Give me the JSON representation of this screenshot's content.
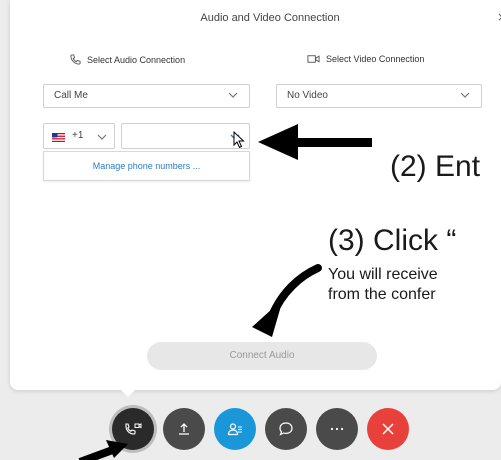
{
  "dialog": {
    "title": "Audio and Video Connection",
    "close_glyph": "×",
    "audio_section_label": "Select Audio Connection",
    "video_section_label": "Select Video Connection",
    "audio_select_value": "Call Me",
    "video_select_value": "No Video",
    "country_code": "+1",
    "phone_number_value": "",
    "manage_link": "Manage phone numbers ...",
    "connect_button": "Connect Audio"
  },
  "icons": {
    "audio": "phone-icon",
    "video": "camera-icon",
    "flag": "us-flag-icon",
    "close": "close-icon"
  },
  "toolbar": {
    "buttons": [
      {
        "name": "audio-connect-button",
        "icon": "phone-video-icon",
        "color": "#2a2a2a"
      },
      {
        "name": "share-button",
        "icon": "upload-icon",
        "color": "#4a4a4a"
      },
      {
        "name": "participants-button",
        "icon": "participants-icon",
        "color": "#1a97d8"
      },
      {
        "name": "chat-button",
        "icon": "chat-bubble-icon",
        "color": "#4a4a4a"
      },
      {
        "name": "more-button",
        "icon": "ellipsis-icon",
        "color": "#4a4a4a"
      },
      {
        "name": "leave-button",
        "icon": "close-icon",
        "color": "#e8413b"
      }
    ]
  },
  "annotations": {
    "step2": "(2) Ent",
    "step3": "(3) Click “",
    "step3_line1": "You will receive",
    "step3_line2": "from the confer"
  },
  "colors": {
    "link": "#2d7bc7",
    "leave_red": "#e8413b",
    "participants_blue": "#1a97d8"
  }
}
